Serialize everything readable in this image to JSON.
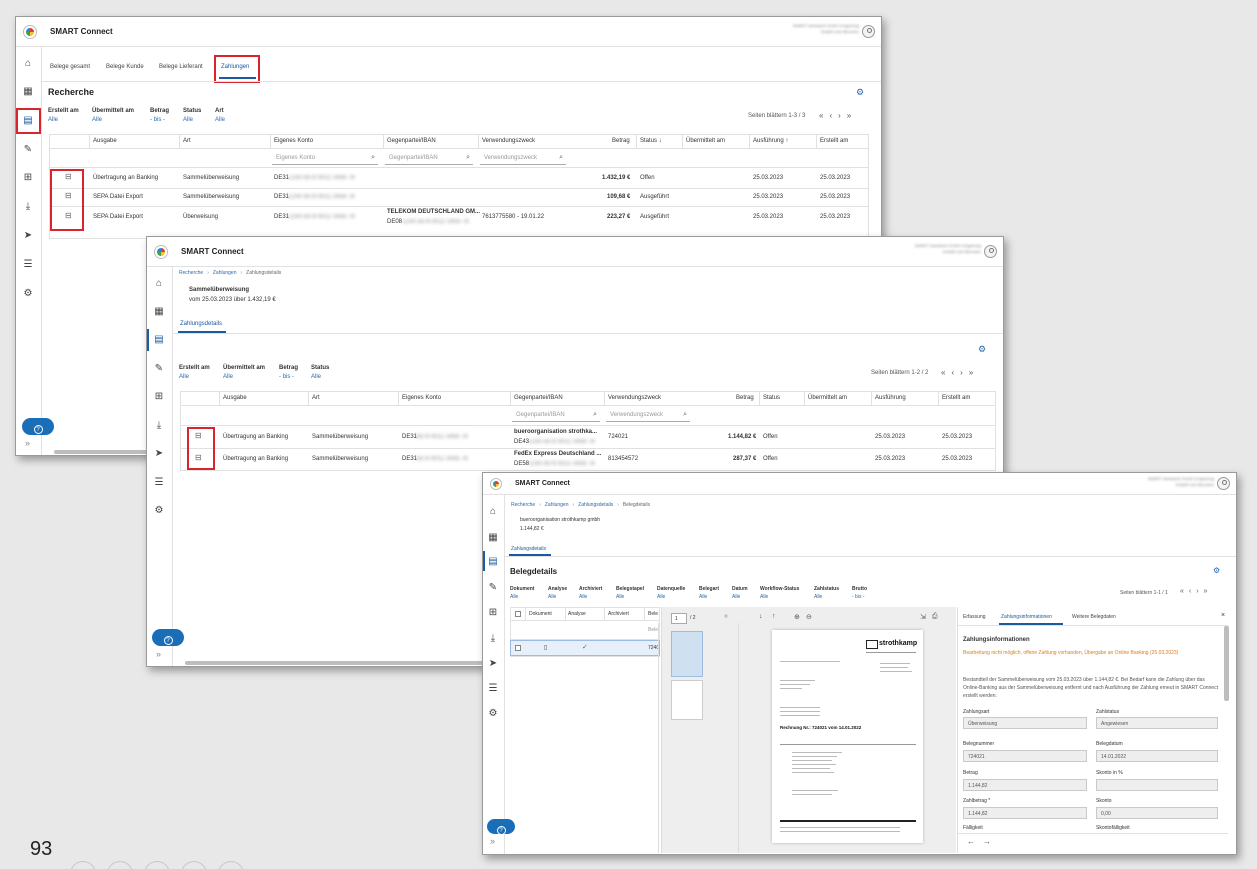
{
  "page_number": "93",
  "app": {
    "title": "SMART Connect",
    "user_line1": "SMART Handwerk GmbH Umgebung",
    "user_line2": "Erstellt vom Benutzer"
  },
  "win1": {
    "tabs": [
      "Belege gesamt",
      "Belege Kunde",
      "Belege Lieferant",
      "Zahlungen"
    ],
    "heading": "Recherche",
    "filters": [
      {
        "label": "Erstellt am",
        "value": "Alle"
      },
      {
        "label": "Übermittelt am",
        "value": "Alle"
      },
      {
        "label": "Betrag",
        "value": "- bis -"
      },
      {
        "label": "Status",
        "value": "Alle"
      },
      {
        "label": "Art",
        "value": "Alle"
      }
    ],
    "pager": "Seiten blättern 1-3 / 3",
    "columns": [
      "Ausgabe",
      "Art",
      "Eigenes Konto",
      "Gegenpartei/IBAN",
      "Verwendungszweck",
      "Betrag",
      "Status ↓",
      "Übermittelt am",
      "Ausführung ↑",
      "Erstellt am"
    ],
    "search": {
      "konto": "Eigenes Konto",
      "iban": "Gegenpartei/IBAN",
      "zweck": "Verwendungszweck"
    },
    "rows": [
      {
        "ausgabe": "Übertragung an Banking",
        "art": "Sammelüberweisung",
        "konto": "DE31",
        "konto_hidden": "1234 5678 9012 3456 78",
        "gegen1": "",
        "gegen2": "",
        "gegen2_hidden": "",
        "zweck": "",
        "betrag": "1.432,19 €",
        "status": "Offen",
        "uebermittelt": "",
        "ausfuehrung": "25.03.2023",
        "erstellt": "25.03.2023"
      },
      {
        "ausgabe": "SEPA Datei Export",
        "art": "Sammelüberweisung",
        "konto": "DE31",
        "konto_hidden": "1234 5678 9012 3456 78",
        "gegen1": "",
        "gegen2": "",
        "gegen2_hidden": "",
        "zweck": "",
        "betrag": "109,68 €",
        "status": "Ausgeführt",
        "uebermittelt": "",
        "ausfuehrung": "25.03.2023",
        "erstellt": "25.03.2023"
      },
      {
        "ausgabe": "SEPA Datei Export",
        "art": "Überweisung",
        "konto": "DE31",
        "konto_hidden": "1234 5678 9012 3456 78",
        "gegen1": "TELEKOM DEUTSCHLAND GM...",
        "gegen2": "DE08",
        "gegen2_hidden": "1234 5678 9012 3456 78",
        "zweck": "7613775580 - 19.01.22",
        "betrag": "223,27 €",
        "status": "Ausgeführt",
        "uebermittelt": "",
        "ausfuehrung": "25.03.2023",
        "erstellt": "25.03.2023"
      }
    ]
  },
  "win2": {
    "breadcrumb": [
      "Recherche",
      "Zahlungen",
      "Zahlungsdetails"
    ],
    "title": "Sammelüberweisung",
    "subtitle": "vom 25.03.2023 über 1.432,19 €",
    "tab": "Zahlungsdetails",
    "filters": [
      {
        "label": "Erstellt am",
        "value": "Alle"
      },
      {
        "label": "Übermittelt am",
        "value": "Alle"
      },
      {
        "label": "Betrag",
        "value": "- bis -"
      },
      {
        "label": "Status",
        "value": "Alle"
      }
    ],
    "pager": "Seiten blättern 1-2 / 2",
    "columns": [
      "Ausgabe",
      "Art",
      "Eigenes Konto",
      "Gegenpartei/IBAN",
      "Verwendungszweck",
      "Betrag",
      "Status",
      "Übermittelt am",
      "Ausführung",
      "Erstellt am"
    ],
    "search": {
      "iban": "Gegenpartei/IBAN",
      "zweck": "Verwendungszweck"
    },
    "rows": [
      {
        "ausgabe": "Übertragung an Banking",
        "art": "Sammelüberweisung",
        "konto": "DE31",
        "konto_hidden": "5678 9012 3456 78",
        "gegen1": "bueroorganisation strothka...",
        "gegen2": "DE43",
        "gegen2_hidden": "1234 5678 9012 3456 78",
        "zweck": "724021",
        "betrag": "1.144,82 €",
        "status": "Offen",
        "ausfuehrung": "25.03.2023",
        "erstellt": "25.03.2023"
      },
      {
        "ausgabe": "Übertragung an Banking",
        "art": "Sammelüberweisung",
        "konto": "DE31",
        "konto_hidden": "5678 9012 3456 78",
        "gegen1": "FedEx Express Deutschland ...",
        "gegen2": "DE58",
        "gegen2_hidden": "1234 5678 9012 3456 78",
        "zweck": "813454572",
        "betrag": "287,37 €",
        "status": "Offen",
        "ausfuehrung": "25.03.2023",
        "erstellt": "25.03.2023"
      }
    ]
  },
  "win3": {
    "breadcrumb": [
      "Recherche",
      "Zahlungen",
      "Zahlungsdetails",
      "Belegdetails"
    ],
    "title": "bueroorganisation strothkamp gmbh",
    "subtitle": "1.144,82 €",
    "tab": "Zahlungsdetails",
    "heading": "Belegdetails",
    "filters": [
      {
        "label": "Dokument",
        "value": "Alle"
      },
      {
        "label": "Analyse",
        "value": "Alle"
      },
      {
        "label": "Archiviert",
        "value": "Alle"
      },
      {
        "label": "Belegstapel",
        "value": "Alle"
      },
      {
        "label": "Datenquelle",
        "value": "Alle"
      },
      {
        "label": "Belegart",
        "value": "Alle"
      },
      {
        "label": "Datum",
        "value": "Alle"
      },
      {
        "label": "Workflow-Status",
        "value": "Alle"
      },
      {
        "label": "Zahlstatus",
        "value": "Alle"
      },
      {
        "label": "Brutto",
        "value": "- bis -"
      }
    ],
    "pager": "Seiten blättern 1-1 / 1",
    "columns": [
      "Dokument",
      "Analyse",
      "Archiviert",
      "Bele"
    ],
    "row": {
      "belege_partial": "Bele",
      "value": "7240"
    },
    "viewer": {
      "page": "1",
      "total": "/ 2",
      "logo": "strothkamp",
      "invoice": "Rechnung Nr.: 724021 vom 14.01.2022"
    },
    "panel": {
      "tabs": [
        "Erfassung",
        "Zahlungsinformationen",
        "Weitere Belegdaten"
      ],
      "heading": "Zahlungsinformationen",
      "warning": "Bearbeitung nicht möglich, offene Zahlung vorhanden, Übergabe an Online Banking (25.03.2023)",
      "info": "Bestandteil der Sammelüberweisung vom 25.03.2023 über 1.144,82 €. Bei Bedarf kann die Zahlung über das Online-Banking aus der Sammelüberweisung entfernt und nach Ausführung der Zahlung erneut in SMART Connect erstellt werden.",
      "fields": [
        {
          "label": "Zahlungsart",
          "value": "Überweisung"
        },
        {
          "label": "Zahlstatus",
          "value": "Angewiesen"
        },
        {
          "label": "Belegnummer",
          "value": "724021"
        },
        {
          "label": "Belegdatum",
          "value": "14.01.2022"
        },
        {
          "label": "Betrag",
          "value": "1.144,82"
        },
        {
          "label": "Skonto in %",
          "value": ""
        },
        {
          "label": "Zahlbetrag *",
          "value": "1.144,82"
        },
        {
          "label": "Skonto",
          "value": "0,00"
        },
        {
          "label": "Fälligkeit",
          "value": ""
        },
        {
          "label": "Skontofälligkeit",
          "value": ""
        }
      ]
    }
  }
}
